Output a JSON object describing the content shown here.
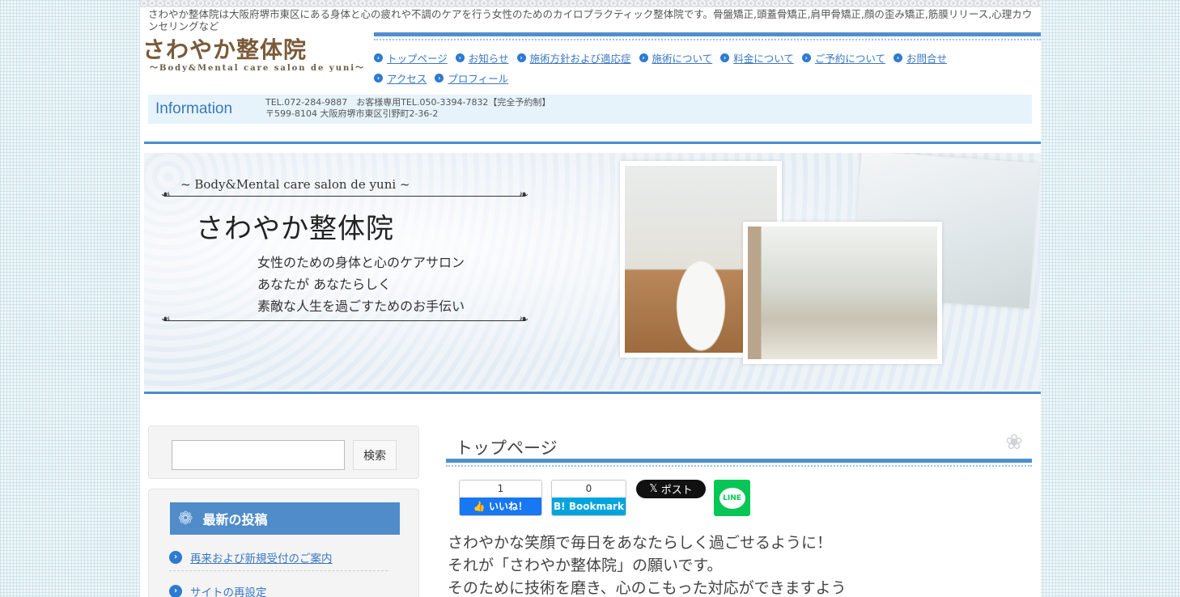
{
  "header": {
    "tagline": "さわやか整体院は大阪府堺市東区にある身体と心の疲れや不調のケアを行う女性のためのカイロプラクティック整体院です。骨盤矯正,頭蓋骨矯正,肩甲骨矯正,顔の歪み矯正,筋膜リリース,心理カウンセリングなど",
    "logo_title": "さわやか整体院",
    "logo_sub": "～Body&Mental care salon de yuni～"
  },
  "nav": {
    "items": [
      {
        "label": "トップページ"
      },
      {
        "label": "お知らせ"
      },
      {
        "label": "施術方針および適応症"
      },
      {
        "label": "施術について"
      },
      {
        "label": "料金について"
      },
      {
        "label": "ご予約について"
      },
      {
        "label": "お問合せ"
      },
      {
        "label": "アクセス"
      },
      {
        "label": "プロフィール"
      }
    ]
  },
  "info": {
    "label": "Information",
    "line1": "TEL.072-284-9887　お客様専用TEL.050-3394-7832【完全予約制】",
    "line2": "〒599-8104 大阪府堺市東区引野町2-36-2"
  },
  "hero": {
    "subtitle": "~ Body&Mental care salon de yuni ~",
    "title": "さわやか整体院",
    "line1": "女性のための身体と心のケアサロン",
    "line2": "あなたが あなたらしく",
    "line3": "素敵な人生を過ごすためのお手伝い"
  },
  "sidebar": {
    "search_button": "検索",
    "search_value": "",
    "recent_title": "最新の投稿",
    "posts": [
      {
        "label": "再来および新規受付のご案内"
      },
      {
        "label": "サイトの再設定"
      }
    ]
  },
  "main": {
    "title": "トップページ",
    "share": {
      "fb_count": "1",
      "fb_label": "いいね！",
      "hatena_count": "0",
      "hatena_label": "B! Bookmark",
      "x_label": "ポスト",
      "line_label": "LINE"
    },
    "body": [
      "さわやかな笑顔で毎日をあなたらしく過ごせるように！",
      "それが「さわやか整体院」の願いです。",
      "そのために技術を磨き、心のこもった対応ができますよう"
    ]
  },
  "colors": {
    "accent": "#4f8fcf",
    "link": "#3a78c2",
    "logo": "#7a5a3a",
    "facebook": "#1877f2",
    "hatena": "#00a4de",
    "line": "#06c755"
  }
}
